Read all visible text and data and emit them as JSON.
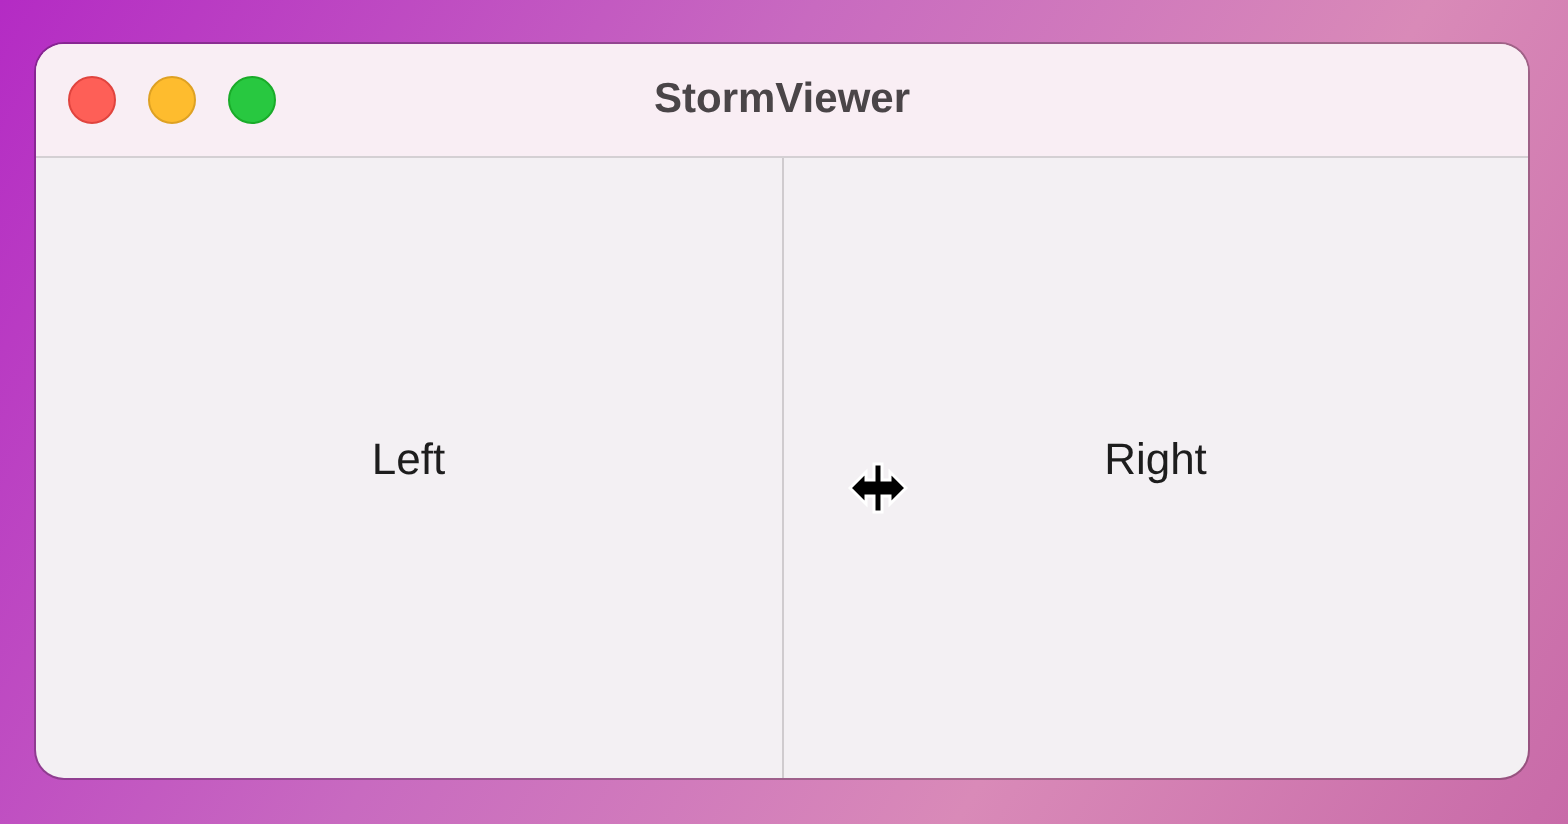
{
  "window": {
    "title": "StormViewer"
  },
  "panes": [
    {
      "label": "Left"
    },
    {
      "label": "Right"
    }
  ]
}
